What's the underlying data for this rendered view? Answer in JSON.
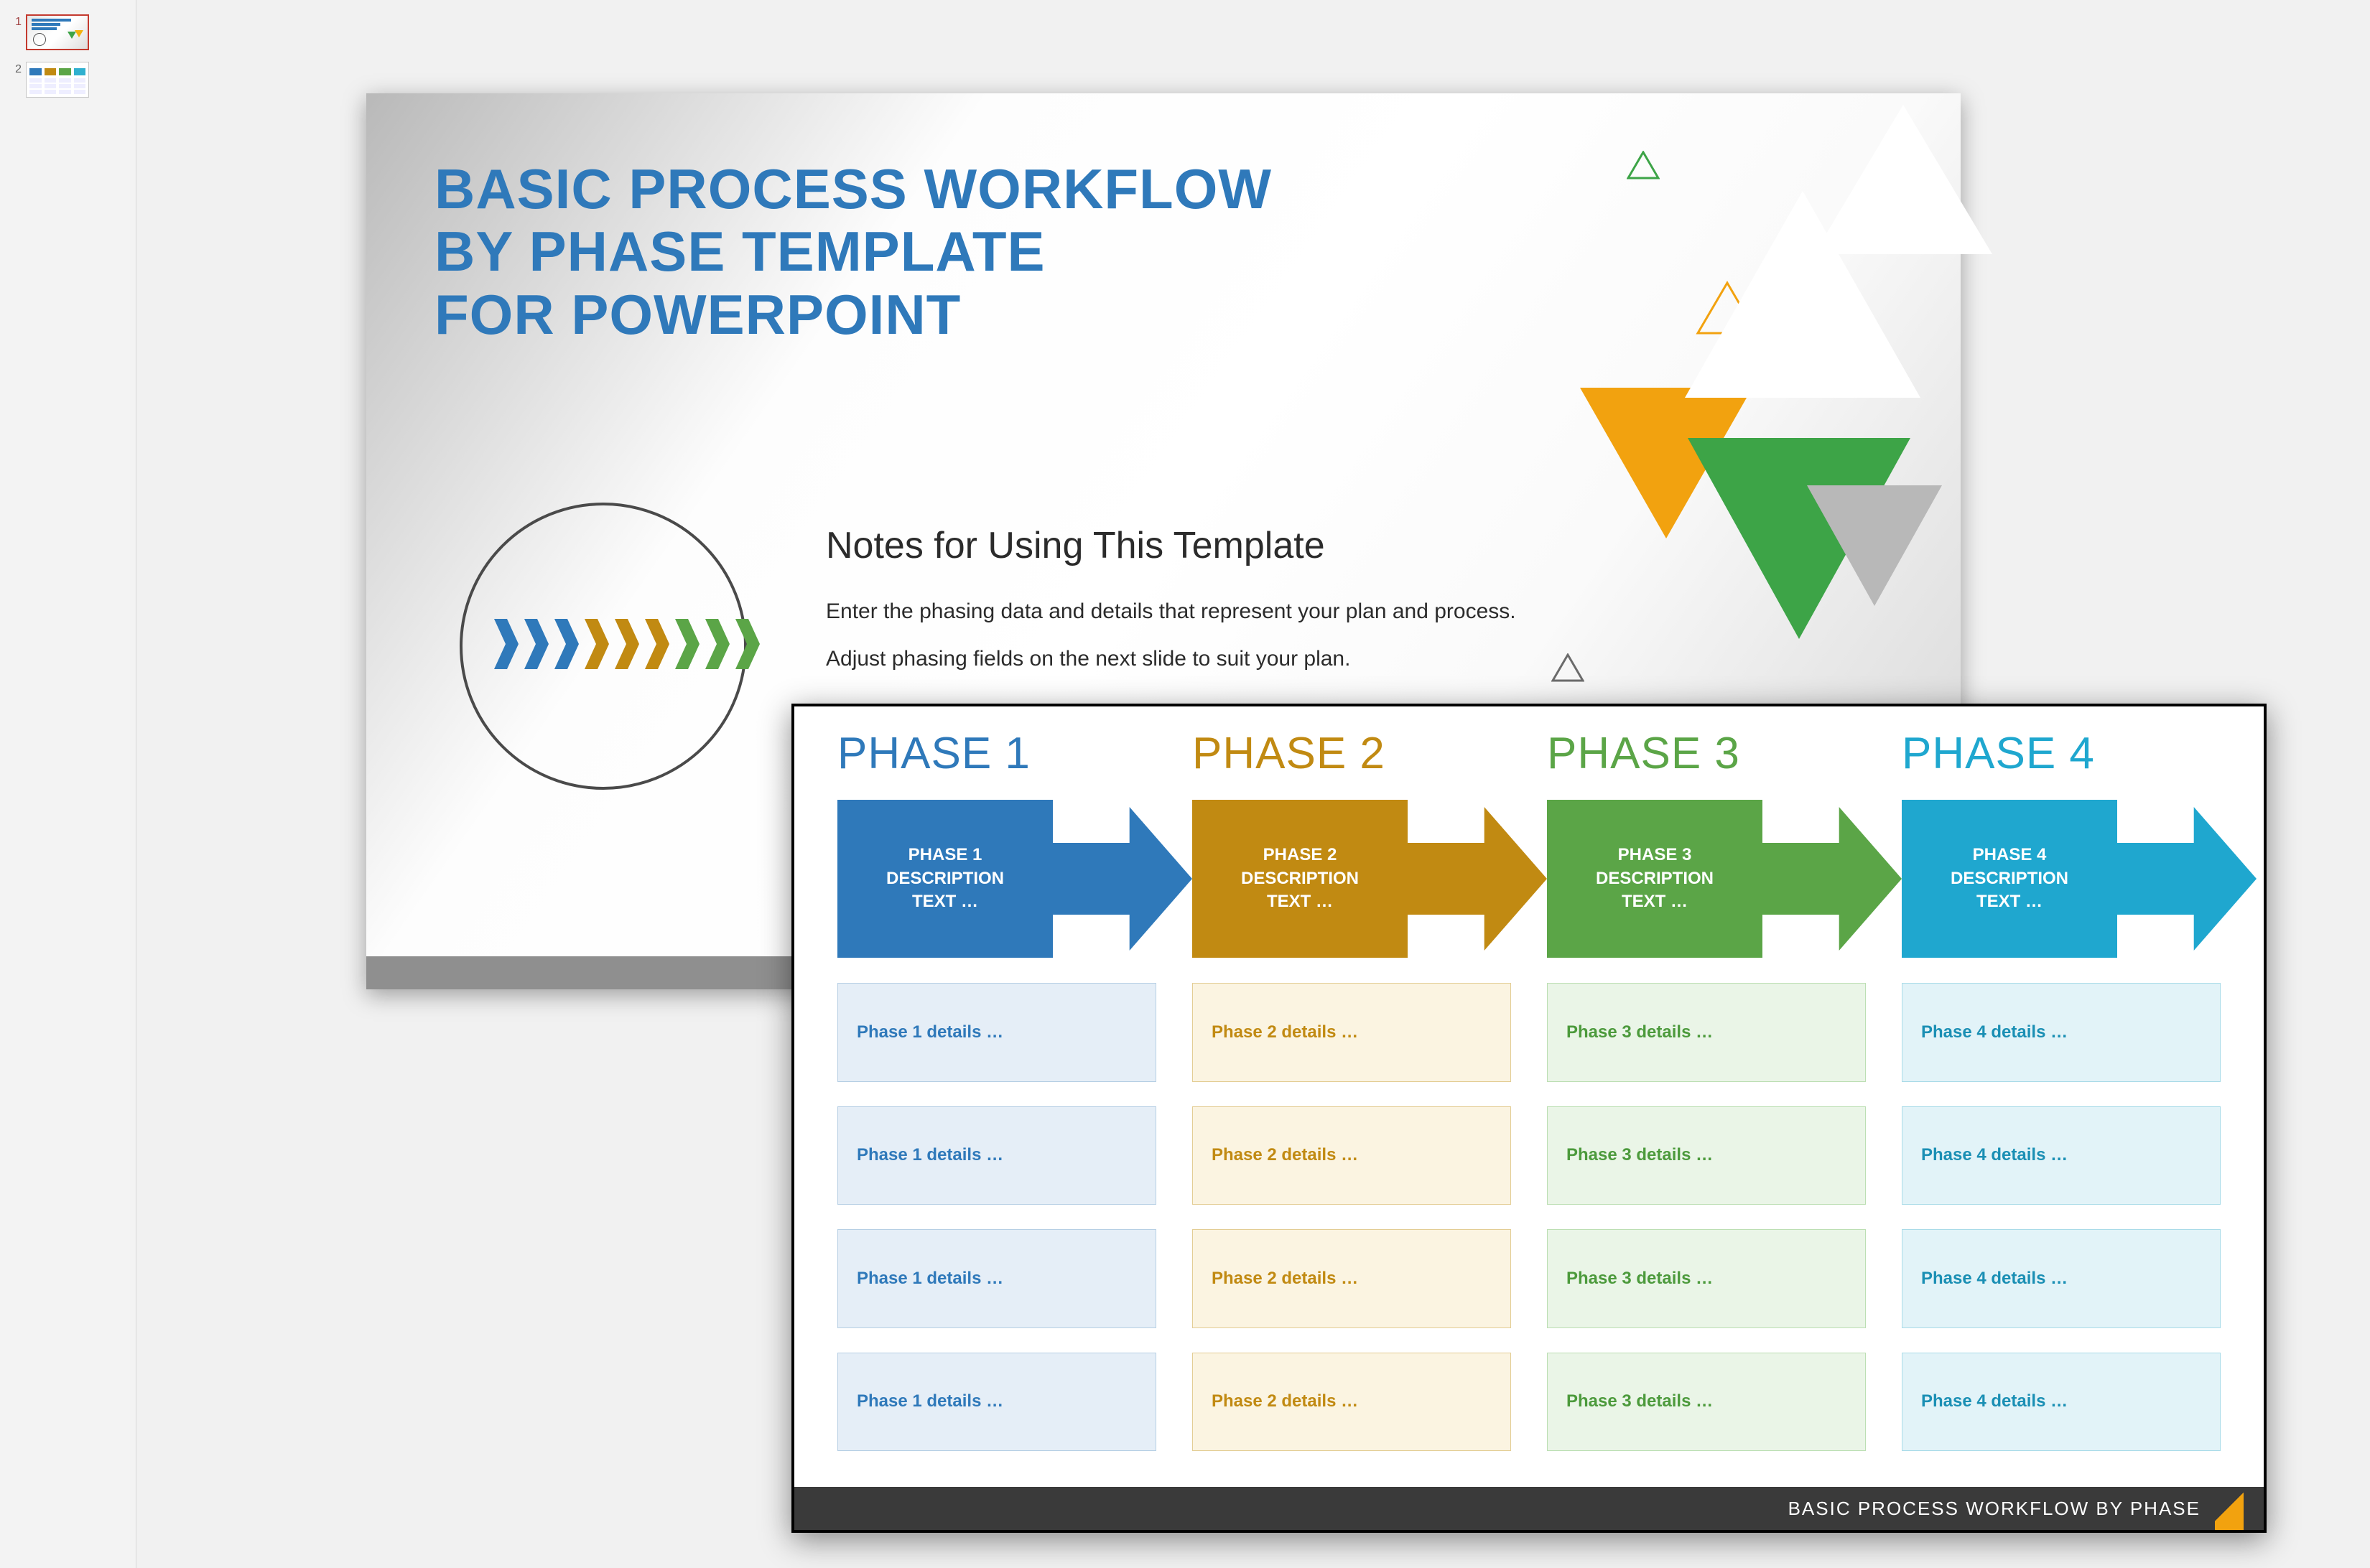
{
  "thumbnails": [
    "1",
    "2"
  ],
  "active_thumbnail_index": 0,
  "slide1": {
    "title_line1": "BASIC PROCESS WORKFLOW",
    "title_line2": "BY PHASE TEMPLATE",
    "title_line3": "FOR POWERPOINT",
    "notes_heading": "Notes for Using This Template",
    "notes_p1": "Enter the phasing data and details that represent your plan and process.",
    "notes_p2": "Adjust phasing fields on the next slide to suit your plan.",
    "chevron_colors": [
      "#2f79ba",
      "#2f79ba",
      "#2f79ba",
      "#c18a12",
      "#c18a12",
      "#c18a12",
      "#5ba547",
      "#5ba547",
      "#5ba547"
    ]
  },
  "slide2": {
    "footer": "BASIC PROCESS WORKFLOW BY PHASE",
    "phases": [
      {
        "title": "PHASE 1",
        "box_l1": "PHASE 1",
        "box_l2": "DESCRIPTION",
        "box_l3": "TEXT …",
        "color": "#2f79ba",
        "details": [
          "Phase 1 details …",
          "Phase 1 details …",
          "Phase 1 details …",
          "Phase 1 details …"
        ]
      },
      {
        "title": "PHASE 2",
        "box_l1": "PHASE 2",
        "box_l2": "DESCRIPTION",
        "box_l3": "TEXT …",
        "color": "#c18a12",
        "details": [
          "Phase 2 details …",
          "Phase 2 details …",
          "Phase 2 details …",
          "Phase 2 details …"
        ]
      },
      {
        "title": "PHASE 3",
        "box_l1": "PHASE 3",
        "box_l2": "DESCRIPTION",
        "box_l3": "TEXT …",
        "color": "#5ba547",
        "details": [
          "Phase 3 details …",
          "Phase 3 details …",
          "Phase 3 details …",
          "Phase 3 details …"
        ]
      },
      {
        "title": "PHASE 4",
        "box_l1": "PHASE 4",
        "box_l2": "DESCRIPTION",
        "box_l3": "TEXT …",
        "color": "#1fa7cf",
        "details": [
          "Phase 4 details …",
          "Phase 4 details …",
          "Phase 4 details …",
          "Phase 4 details …"
        ]
      }
    ]
  }
}
